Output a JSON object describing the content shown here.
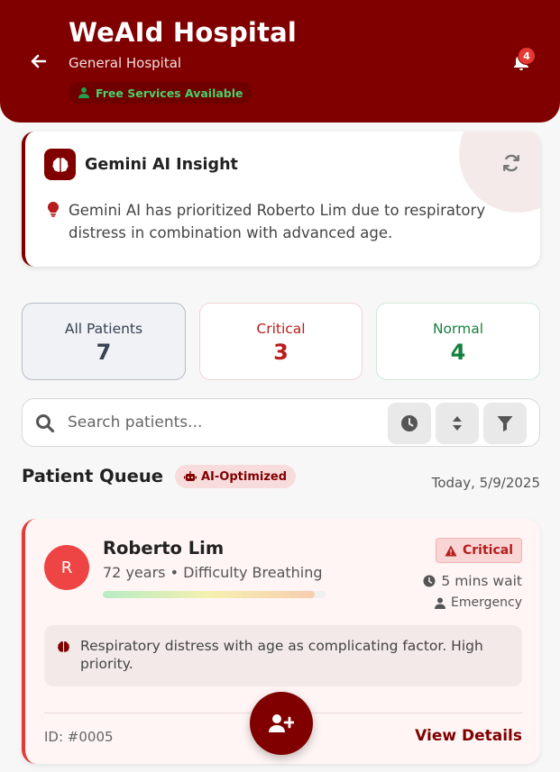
{
  "header": {
    "title": "WeAId Hospital",
    "subtitle": "General Hospital",
    "free_badge": "Free Services Available",
    "notification_count": "4",
    "icons": {
      "back": "arrow-left-icon",
      "notifications": "bell-icon",
      "free": "user-icon"
    }
  },
  "insight": {
    "title": "Gemini AI Insight",
    "text": "Gemini AI has prioritized Roberto Lim due to respiratory distress in combination with advanced age.",
    "icons": {
      "brain": "brain-icon",
      "refresh": "refresh-icon",
      "bulb": "lightbulb-icon"
    }
  },
  "stats": [
    {
      "label": "All Patients",
      "value": "7",
      "color": "#374151"
    },
    {
      "label": "Critical",
      "value": "3",
      "color": "#b91c1c"
    },
    {
      "label": "Normal",
      "value": "4",
      "color": "#15803d"
    }
  ],
  "search": {
    "placeholder": "Search patients...",
    "icons": [
      "search-icon",
      "clock-icon",
      "sort-icon",
      "filter-icon"
    ]
  },
  "queue": {
    "title": "Patient Queue",
    "badge": "AI-Optimized",
    "date": "Today, 5/9/2025"
  },
  "patient": {
    "initial": "R",
    "name": "Roberto Lim",
    "meta": "72 years • Difficulty Breathing",
    "priority_fraction": 0.95,
    "status": "Critical",
    "wait": "5 mins wait",
    "type": "Emergency",
    "note": "Respiratory distress with age as complicating factor. High priority.",
    "id": "ID: #0005",
    "details": "View Details"
  },
  "colors": {
    "brand": "#800000",
    "critical": "#e53935",
    "success": "#22a04a"
  },
  "fab": {
    "icon": "add-user-icon"
  }
}
